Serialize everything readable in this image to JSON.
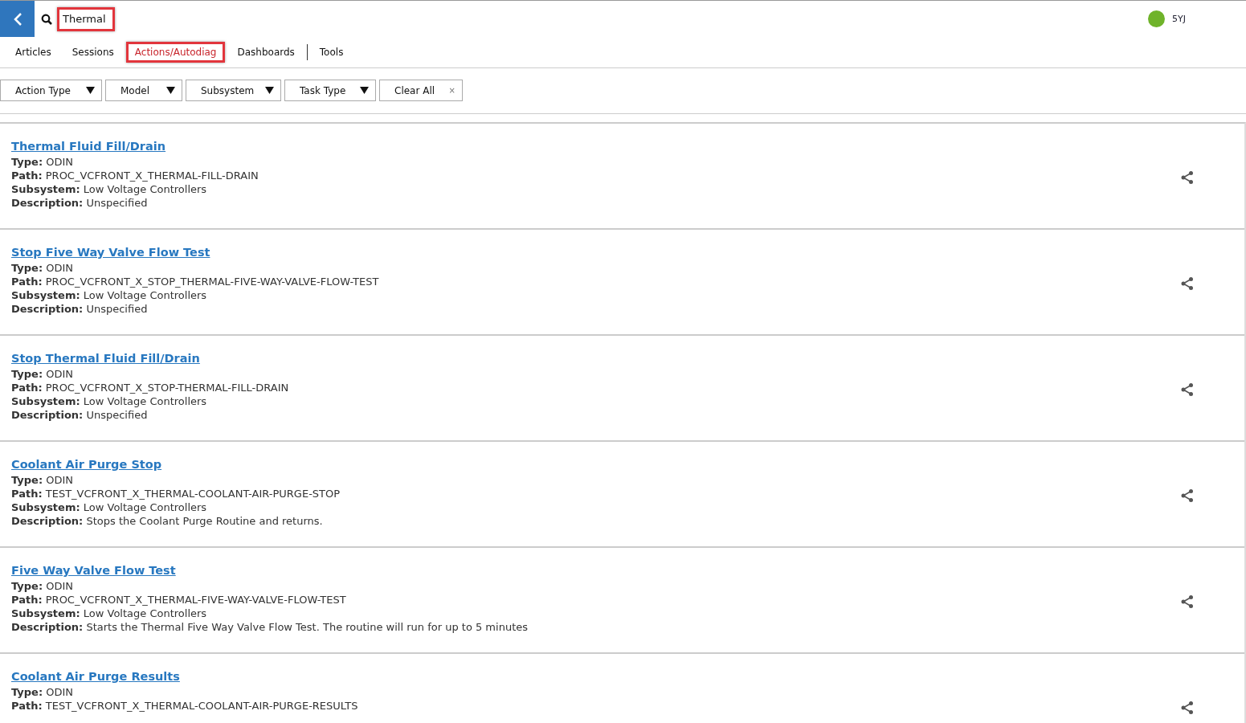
{
  "search": {
    "value": "Thermal"
  },
  "user": {
    "label": "5YJ",
    "color": "#6fb32a"
  },
  "tabs": [
    {
      "label": "Articles",
      "selected": false
    },
    {
      "label": "Sessions",
      "selected": false
    },
    {
      "label": "Actions/Autodiag",
      "selected": true
    },
    {
      "label": "Dashboards",
      "selected": false
    },
    {
      "label": "Tools",
      "selected": false
    }
  ],
  "filters": [
    {
      "label": "Action Type",
      "kind": "dropdown"
    },
    {
      "label": "Model",
      "kind": "dropdown"
    },
    {
      "label": "Subsystem",
      "kind": "dropdown"
    },
    {
      "label": "Task Type",
      "kind": "dropdown"
    },
    {
      "label": "Clear All",
      "kind": "clear",
      "icon": "×"
    }
  ],
  "results": [
    {
      "title": "Thermal Fluid Fill/Drain",
      "fields": [
        {
          "label": "Type:",
          "value": "ODIN"
        },
        {
          "label": "Path:",
          "value": "PROC_VCFRONT_X_THERMAL-FILL-DRAIN"
        },
        {
          "label": "Subsystem:",
          "value": "Low Voltage Controllers"
        },
        {
          "label": "Description:",
          "value": "Unspecified"
        }
      ]
    },
    {
      "title": "Stop Five Way Valve Flow Test",
      "fields": [
        {
          "label": "Type:",
          "value": "ODIN"
        },
        {
          "label": "Path:",
          "value": "PROC_VCFRONT_X_STOP_THERMAL-FIVE-WAY-VALVE-FLOW-TEST"
        },
        {
          "label": "Subsystem:",
          "value": "Low Voltage Controllers"
        },
        {
          "label": "Description:",
          "value": "Unspecified"
        }
      ]
    },
    {
      "title": "Stop Thermal Fluid Fill/Drain",
      "fields": [
        {
          "label": "Type:",
          "value": "ODIN"
        },
        {
          "label": "Path:",
          "value": "PROC_VCFRONT_X_STOP-THERMAL-FILL-DRAIN"
        },
        {
          "label": "Subsystem:",
          "value": "Low Voltage Controllers"
        },
        {
          "label": "Description:",
          "value": "Unspecified"
        }
      ]
    },
    {
      "title": "Coolant Air Purge Stop",
      "fields": [
        {
          "label": "Type:",
          "value": "ODIN"
        },
        {
          "label": "Path:",
          "value": "TEST_VCFRONT_X_THERMAL-COOLANT-AIR-PURGE-STOP"
        },
        {
          "label": "Subsystem:",
          "value": "Low Voltage Controllers"
        },
        {
          "label": "Description:",
          "value": "Stops the Coolant Purge Routine and returns."
        }
      ]
    },
    {
      "title": "Five Way Valve Flow Test",
      "fields": [
        {
          "label": "Type:",
          "value": "ODIN"
        },
        {
          "label": "Path:",
          "value": "PROC_VCFRONT_X_THERMAL-FIVE-WAY-VALVE-FLOW-TEST"
        },
        {
          "label": "Subsystem:",
          "value": "Low Voltage Controllers"
        },
        {
          "label": "Description:",
          "value": "Starts the Thermal Five Way Valve Flow Test. The routine will run for up to 5 minutes"
        }
      ]
    },
    {
      "title": "Coolant Air Purge Results",
      "fields": [
        {
          "label": "Type:",
          "value": "ODIN"
        },
        {
          "label": "Path:",
          "value": "TEST_VCFRONT_X_THERMAL-COOLANT-AIR-PURGE-RESULTS"
        }
      ]
    }
  ]
}
